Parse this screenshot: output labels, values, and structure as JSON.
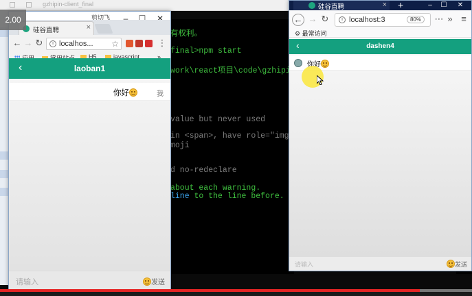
{
  "desktop": {
    "path_label": "gzhipin-client_final"
  },
  "terminal": {
    "lines": [
      "有权利。",
      "final>npm start",
      "work\\react项目\\code\\gzhipin",
      "value but never used",
      "in <span>, have role=\"img\",",
      "moji",
      "d  no-redeclare",
      "about each warning.",
      "line to the line before."
    ]
  },
  "left_window": {
    "window_title": "剪切飞",
    "tab_label": "硅谷直聘",
    "url": "localhos...",
    "bookmarks": [
      "应用",
      "常用站点",
      "H5",
      "javascript"
    ],
    "more": "»",
    "header_title": "laoban1",
    "message_text": "你好",
    "message_sender": "我",
    "input_placeholder": "请输入",
    "send_label": "发送"
  },
  "right_window": {
    "tab_label": "硅谷直聘",
    "url": "localhost:3",
    "zoom": "80%",
    "bookmark": "最常访问",
    "header_title": "dashen4",
    "message_text": "你好",
    "input_placeholder": "请输入",
    "send_label": "发送"
  },
  "video": {
    "time": "2.00",
    "progress": 0.89
  },
  "colors": {
    "app_green": "#14a07f",
    "terminal_green": "#3fbf3f",
    "highlight_blue": "#3aa0e8",
    "progress_red": "#e52525"
  }
}
